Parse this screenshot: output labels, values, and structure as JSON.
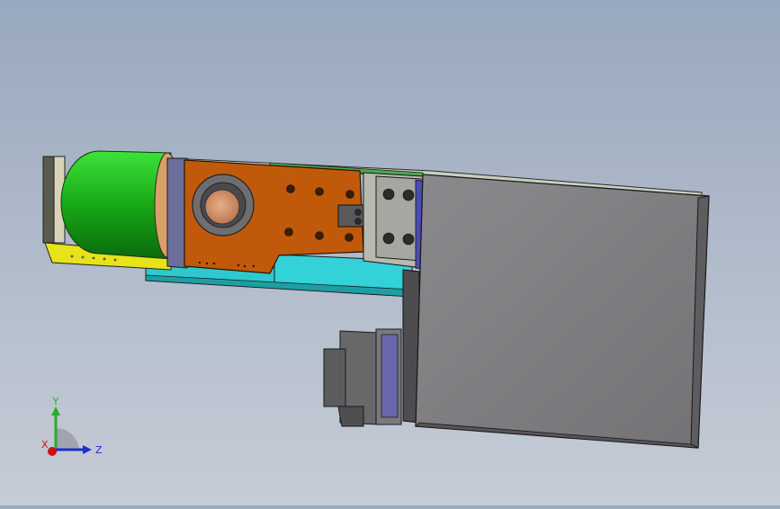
{
  "viewport": {
    "background_top": "#98a8be",
    "background_bottom": "#c6ccd6",
    "model_colors": {
      "motor_green": "#1fb31c",
      "plate_orange": "#c05a0a",
      "base_cyan": "#2ec9cf",
      "base_yellow": "#e7e21a",
      "housing_grey": "#7d7d80",
      "bearing_copper": "#d9956a"
    }
  },
  "triad": {
    "x_label": "X",
    "y_label": "Y",
    "z_label": "Z",
    "x_color": "#d01010",
    "y_color": "#20b020",
    "z_color": "#2030c8",
    "icon": "coordinate-triad-icon"
  }
}
